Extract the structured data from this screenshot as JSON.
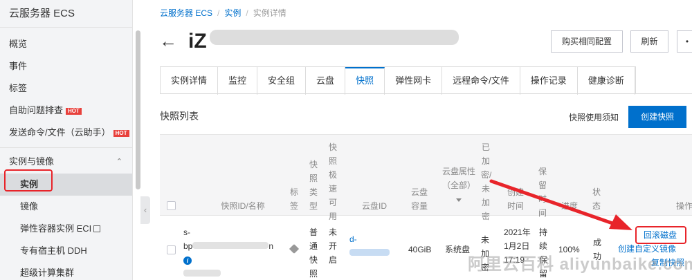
{
  "sidebar": {
    "title": "云服务器 ECS",
    "items": [
      {
        "label": "概览"
      },
      {
        "label": "事件"
      },
      {
        "label": "标签"
      },
      {
        "label": "自助问题排查",
        "badge": "HOT"
      },
      {
        "label": "发送命令/文件（云助手）",
        "badge": "HOT"
      }
    ],
    "group": {
      "label": "实例与镜像",
      "children": [
        {
          "label": "实例"
        },
        {
          "label": "镜像"
        },
        {
          "label": "弹性容器实例 ECI"
        },
        {
          "label": "专有宿主机 DDH"
        },
        {
          "label": "超级计算集群"
        }
      ]
    }
  },
  "breadcrumb": [
    "云服务器 ECS",
    "实例",
    "实例详情"
  ],
  "page_title_prefix": "iZ",
  "header_buttons": {
    "buy_same": "购买相同配置",
    "refresh": "刷新"
  },
  "tabs": [
    {
      "label": "实例详情"
    },
    {
      "label": "监控"
    },
    {
      "label": "安全组"
    },
    {
      "label": "云盘"
    },
    {
      "label": "快照",
      "active": true
    },
    {
      "label": "弹性网卡"
    },
    {
      "label": "远程命令/文件"
    },
    {
      "label": "操作记录"
    },
    {
      "label": "健康诊断"
    }
  ],
  "section": {
    "title": "快照列表",
    "notice_link": "快照使用须知",
    "create_button": "创建快照"
  },
  "table": {
    "headers": {
      "id": "快照ID/名称",
      "tag": "标签",
      "type": "快照类型",
      "fast": "快照极速可用",
      "disk_id": "云盘ID",
      "capacity": "云盘容量",
      "disk_attr": "云盘属性（全部）",
      "encrypted": "已加密/未加密",
      "created": "创建时间",
      "retention": "保留时间",
      "progress": "进度",
      "status": "状态",
      "actions": "操作"
    },
    "row": {
      "id_prefix": "s-",
      "id_line2": "bp",
      "id_suffix": "n",
      "type": "普通快照",
      "fast": "未开启",
      "disk_prefix": "d-",
      "capacity": "40GiB",
      "disk_attr": "系统盘",
      "encrypted": "未加密",
      "created": "2021年1月2日17:19",
      "retention": "持续保留",
      "progress": "100%",
      "status": "成功",
      "actions": {
        "rollback": "回滚磁盘",
        "create_image": "创建自定义镜像",
        "copy": "复制快照"
      }
    }
  },
  "watermark": "阿里云百科 aliyunbaike.com",
  "colors": {
    "primary": "#0070cc",
    "highlight_red": "#e8242a",
    "hot_badge": "#e8413c"
  }
}
